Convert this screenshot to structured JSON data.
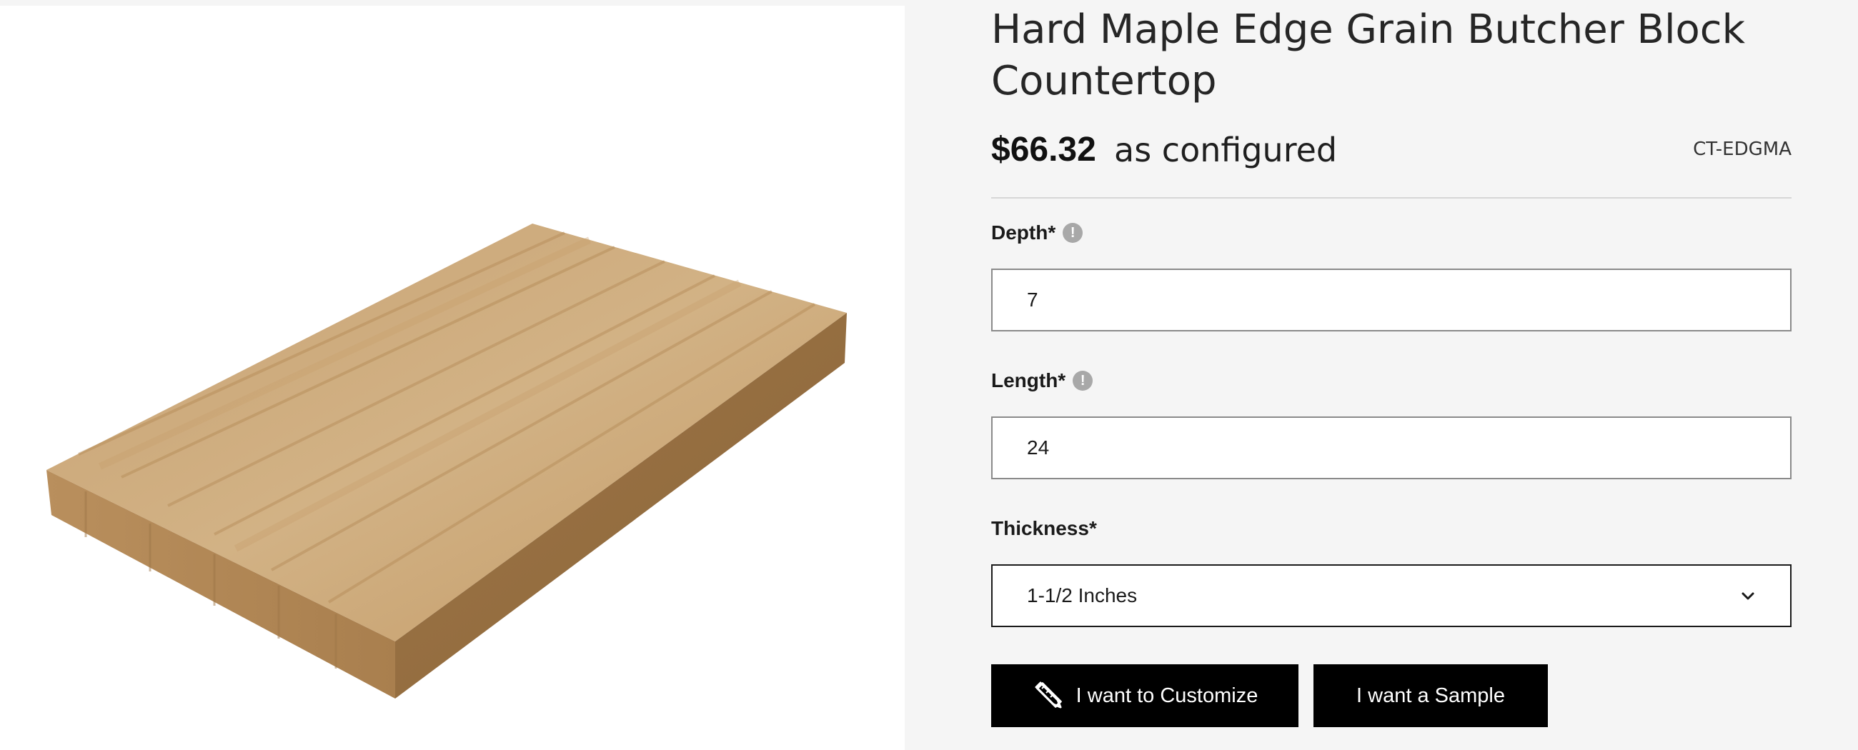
{
  "product": {
    "title": "Hard Maple Edge Grain Butcher Block Countertop",
    "price": "$66.32",
    "price_suffix": "as configured",
    "sku": "CT-EDGMA"
  },
  "fields": {
    "depth": {
      "label": "Depth*",
      "value": "7",
      "info_icon": "info-icon"
    },
    "length": {
      "label": "Length*",
      "value": "24",
      "info_icon": "info-icon"
    },
    "thickness": {
      "label": "Thickness*",
      "selected": "1-1/2 Inches",
      "icon": "chevron-down-icon"
    }
  },
  "buttons": {
    "customize": {
      "label": "I want to Customize",
      "icon": "pencil-ruler-icon"
    },
    "sample": {
      "label": "I want a Sample"
    }
  },
  "colors": {
    "background": "#f5f5f5",
    "button": "#000000",
    "button_text": "#ffffff",
    "wood_top": "#c9a574",
    "wood_side": "#b88d58"
  }
}
